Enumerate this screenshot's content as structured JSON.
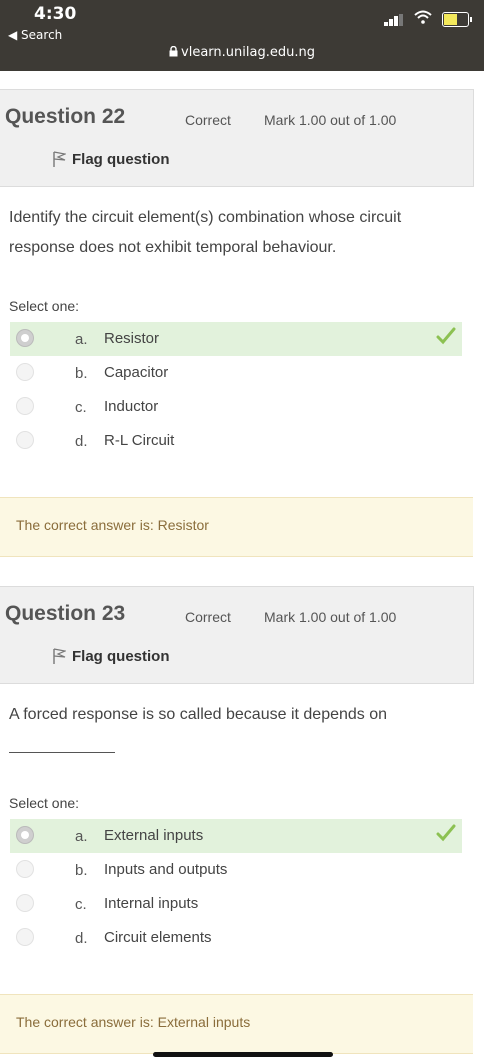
{
  "status_bar": {
    "time": "4:30",
    "back_label": "◀ Search",
    "url": "vlearn.unilag.edu.ng"
  },
  "questions": [
    {
      "number": "Question 22",
      "state": "Correct",
      "mark": "Mark 1.00 out of 1.00",
      "flag_label": "Flag question",
      "text": "Identify the circuit element(s) combination whose circuit response does not exhibit temporal behaviour.",
      "select_label": "Select one:",
      "options": [
        {
          "letter": "a.",
          "text": "Resistor",
          "selected": true,
          "correct": true
        },
        {
          "letter": "b.",
          "text": "Capacitor",
          "selected": false,
          "correct": false
        },
        {
          "letter": "c.",
          "text": "Inductor",
          "selected": false,
          "correct": false
        },
        {
          "letter": "d.",
          "text": "R-L Circuit",
          "selected": false,
          "correct": false
        }
      ],
      "feedback": "The correct answer is: Resistor"
    },
    {
      "number": "Question 23",
      "state": "Correct",
      "mark": "Mark 1.00 out of 1.00",
      "flag_label": "Flag question",
      "text": "A forced response is so called because it depends on",
      "select_label": "Select one:",
      "options": [
        {
          "letter": "a.",
          "text": "External inputs",
          "selected": true,
          "correct": true
        },
        {
          "letter": "b.",
          "text": "Inputs and outputs",
          "selected": false,
          "correct": false
        },
        {
          "letter": "c.",
          "text": "Internal inputs",
          "selected": false,
          "correct": false
        },
        {
          "letter": "d.",
          "text": "Circuit elements",
          "selected": false,
          "correct": false
        }
      ],
      "feedback": "The correct answer is: External inputs"
    }
  ],
  "colors": {
    "status_bar": "#3d3a35",
    "question_header": "#f0f0f0",
    "correct_option": "#e2f2dc",
    "feedback_bg": "#fcf8e3",
    "feedback_text": "#8a6d3b",
    "tick": "#8cc152"
  },
  "icons": [
    "lock-icon",
    "signal-icon",
    "wifi-icon",
    "battery-icon",
    "flag-icon",
    "checkmark-icon",
    "radio-icon"
  ]
}
